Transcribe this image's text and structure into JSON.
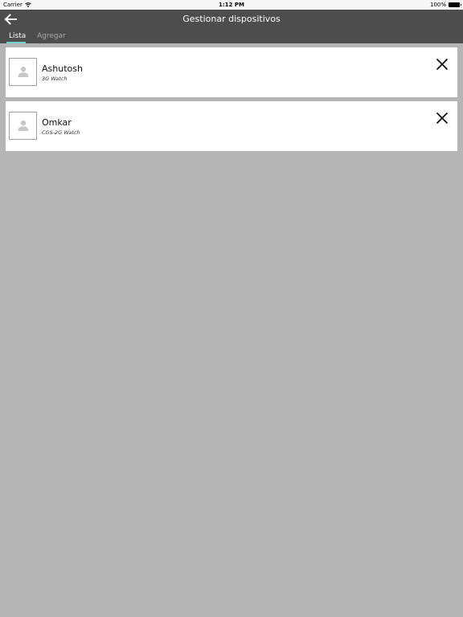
{
  "status_bar": {
    "carrier": "Carrier",
    "time": "1:12 PM",
    "battery": "100%",
    "wifi_icon": "wifi-icon",
    "battery_icon": "battery-icon"
  },
  "header": {
    "title": "Gestionar dispositivos",
    "back_icon": "arrow-left-icon",
    "tabs": [
      {
        "label": "Lista",
        "active": true
      },
      {
        "label": "Agregar",
        "active": false
      }
    ]
  },
  "devices": [
    {
      "name": "Ashutosh",
      "model": "3G Watch"
    },
    {
      "name": "Omkar",
      "model": "CGS-2G Watch"
    }
  ],
  "colors": {
    "header_bg": "#4d4d4d",
    "tab_indicator": "#6ed3c8",
    "page_bg": "#b5b5b5",
    "card_bg": "#ffffff"
  }
}
